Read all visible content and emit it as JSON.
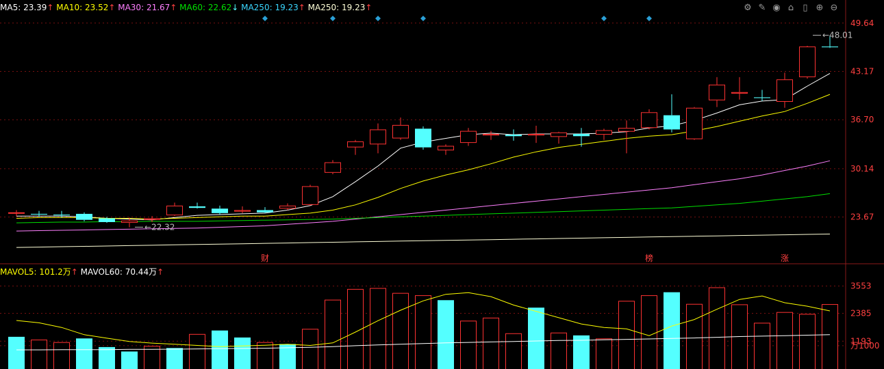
{
  "chart_data": {
    "type": "candlestick",
    "price_panel": {
      "y_ticks": [
        "49.64",
        "43.17",
        "36.70",
        "30.14",
        "23.67"
      ],
      "ylim": [
        17.6,
        50.9
      ],
      "annotations": [
        {
          "text": "48.01",
          "candle_index": 35,
          "price": 48.01,
          "kind": "high"
        },
        {
          "text": "22.32",
          "candle_index": 5,
          "price": 22.32,
          "kind": "low"
        }
      ],
      "event_markers": [
        {
          "text": "财",
          "candle_index": 11
        },
        {
          "text": "榜",
          "candle_index": 28
        },
        {
          "text": "涨",
          "candle_index": 34
        }
      ],
      "top_markers": [
        11,
        14,
        16,
        18,
        26,
        28
      ],
      "candles": [
        {
          "o": 24.2,
          "h": 24.6,
          "l": 23.8,
          "c": 24.3
        },
        {
          "o": 24.1,
          "h": 24.5,
          "l": 23.7,
          "c": 24.0
        },
        {
          "o": 24.0,
          "h": 24.5,
          "l": 23.6,
          "c": 23.9
        },
        {
          "o": 24.1,
          "h": 24.3,
          "l": 23.1,
          "c": 23.3
        },
        {
          "o": 23.5,
          "h": 23.7,
          "l": 22.9,
          "c": 23.0
        },
        {
          "o": 22.9,
          "h": 23.6,
          "l": 22.3,
          "c": 23.2
        },
        {
          "o": 23.3,
          "h": 23.8,
          "l": 23.0,
          "c": 23.5
        },
        {
          "o": 23.9,
          "h": 25.6,
          "l": 23.8,
          "c": 25.2
        },
        {
          "o": 25.1,
          "h": 25.6,
          "l": 24.8,
          "c": 24.9
        },
        {
          "o": 24.8,
          "h": 25.2,
          "l": 24.0,
          "c": 24.2
        },
        {
          "o": 24.4,
          "h": 25.1,
          "l": 24.2,
          "c": 24.6
        },
        {
          "o": 24.6,
          "h": 25.0,
          "l": 24.2,
          "c": 24.3
        },
        {
          "o": 24.8,
          "h": 25.5,
          "l": 24.6,
          "c": 25.2
        },
        {
          "o": 25.3,
          "h": 28.0,
          "l": 25.2,
          "c": 27.8
        },
        {
          "o": 29.6,
          "h": 31.3,
          "l": 29.4,
          "c": 31.0
        },
        {
          "o": 33.0,
          "h": 34.0,
          "l": 32.0,
          "c": 33.8
        },
        {
          "o": 33.4,
          "h": 36.2,
          "l": 32.2,
          "c": 35.4
        },
        {
          "o": 34.2,
          "h": 37.0,
          "l": 34.0,
          "c": 36.0
        },
        {
          "o": 35.5,
          "h": 35.8,
          "l": 32.7,
          "c": 33.0
        },
        {
          "o": 32.6,
          "h": 33.4,
          "l": 32.0,
          "c": 33.2
        },
        {
          "o": 33.6,
          "h": 35.6,
          "l": 33.2,
          "c": 35.2
        },
        {
          "o": 34.6,
          "h": 35.2,
          "l": 34.0,
          "c": 34.8
        },
        {
          "o": 34.7,
          "h": 35.4,
          "l": 33.9,
          "c": 34.5
        },
        {
          "o": 34.6,
          "h": 35.9,
          "l": 33.6,
          "c": 34.8
        },
        {
          "o": 34.4,
          "h": 35.1,
          "l": 33.5,
          "c": 35.0
        },
        {
          "o": 34.8,
          "h": 35.6,
          "l": 33.1,
          "c": 34.5
        },
        {
          "o": 34.7,
          "h": 35.5,
          "l": 34.0,
          "c": 35.3
        },
        {
          "o": 35.1,
          "h": 36.6,
          "l": 32.2,
          "c": 35.6
        },
        {
          "o": 35.6,
          "h": 38.1,
          "l": 35.4,
          "c": 37.7
        },
        {
          "o": 37.3,
          "h": 40.1,
          "l": 35.0,
          "c": 35.4
        },
        {
          "o": 34.1,
          "h": 38.4,
          "l": 34.0,
          "c": 38.3
        },
        {
          "o": 39.3,
          "h": 42.4,
          "l": 38.4,
          "c": 41.4
        },
        {
          "o": 40.2,
          "h": 42.4,
          "l": 39.4,
          "c": 40.4
        },
        {
          "o": 39.7,
          "h": 40.7,
          "l": 39.2,
          "c": 39.6
        },
        {
          "o": 39.1,
          "h": 43.0,
          "l": 38.3,
          "c": 42.1
        },
        {
          "o": 42.4,
          "h": 46.6,
          "l": 42.2,
          "c": 46.5
        },
        {
          "o": 46.5,
          "h": 48.0,
          "l": 46.3,
          "c": 46.4
        }
      ],
      "ma_lines": [
        {
          "name": "MA5",
          "color": "#ffffff",
          "values": [
            23.8,
            23.8,
            23.8,
            23.7,
            23.5,
            23.4,
            23.3,
            23.6,
            23.9,
            24.0,
            24.1,
            24.2,
            24.6,
            25.2,
            26.4,
            28.4,
            30.5,
            32.9,
            33.7,
            34.2,
            34.7,
            34.9,
            34.7,
            34.8,
            34.8,
            34.8,
            34.9,
            35.1,
            35.6,
            35.9,
            36.6,
            37.6,
            38.7,
            39.2,
            39.4,
            41.2,
            42.9
          ]
        },
        {
          "name": "MA10",
          "color": "#ffff00",
          "values": [
            23.5,
            23.6,
            23.6,
            23.6,
            23.5,
            23.5,
            23.4,
            23.5,
            23.6,
            23.7,
            23.8,
            23.8,
            24.0,
            24.2,
            24.6,
            25.3,
            26.3,
            27.5,
            28.5,
            29.3,
            30.0,
            30.8,
            31.7,
            32.4,
            33.0,
            33.4,
            33.8,
            34.2,
            34.5,
            34.7,
            35.2,
            35.8,
            36.5,
            37.2,
            37.8,
            38.9,
            40.1
          ]
        },
        {
          "name": "MA30",
          "color": "#ff80ff",
          "values": [
            21.8,
            21.85,
            21.9,
            21.95,
            22.0,
            22.05,
            22.1,
            22.15,
            22.2,
            22.3,
            22.4,
            22.5,
            22.7,
            22.9,
            23.1,
            23.4,
            23.7,
            24.0,
            24.3,
            24.6,
            24.9,
            25.2,
            25.5,
            25.8,
            26.1,
            26.4,
            26.7,
            27.0,
            27.3,
            27.6,
            28.0,
            28.4,
            28.8,
            29.3,
            29.9,
            30.5,
            31.2
          ]
        },
        {
          "name": "MA60",
          "color": "#00e000",
          "values": [
            22.9,
            22.95,
            23.0,
            23.0,
            23.05,
            23.05,
            23.1,
            23.1,
            23.1,
            23.15,
            23.2,
            23.25,
            23.3,
            23.35,
            23.4,
            23.5,
            23.6,
            23.7,
            23.8,
            23.9,
            24.0,
            24.1,
            24.2,
            24.3,
            24.4,
            24.5,
            24.6,
            24.7,
            24.8,
            24.9,
            25.1,
            25.3,
            25.5,
            25.8,
            26.1,
            26.4,
            26.8
          ]
        },
        {
          "name": "MA250",
          "color": "#ffffd8",
          "values": [
            19.6,
            19.65,
            19.7,
            19.75,
            19.8,
            19.85,
            19.9,
            19.95,
            20.0,
            20.05,
            20.1,
            20.15,
            20.2,
            20.25,
            20.3,
            20.35,
            20.4,
            20.45,
            20.5,
            20.55,
            20.6,
            20.65,
            20.7,
            20.75,
            20.8,
            20.85,
            20.9,
            20.95,
            21.0,
            21.05,
            21.1,
            21.15,
            21.2,
            21.25,
            21.3,
            21.35,
            21.4
          ]
        }
      ]
    },
    "volume_panel": {
      "y_ticks": [
        "3553",
        "2385",
        "1193",
        "万1000"
      ],
      "ylim": [
        0,
        4100
      ],
      "bars": [
        {
          "v": 1380,
          "down": true
        },
        {
          "v": 1260,
          "down": false
        },
        {
          "v": 1150,
          "down": false
        },
        {
          "v": 1310,
          "down": true
        },
        {
          "v": 940,
          "down": true
        },
        {
          "v": 750,
          "down": true
        },
        {
          "v": 990,
          "down": false
        },
        {
          "v": 900,
          "down": true
        },
        {
          "v": 1500,
          "down": false
        },
        {
          "v": 1650,
          "down": true
        },
        {
          "v": 1350,
          "down": true
        },
        {
          "v": 1150,
          "down": false
        },
        {
          "v": 1070,
          "down": true
        },
        {
          "v": 1720,
          "down": false
        },
        {
          "v": 2970,
          "down": false
        },
        {
          "v": 3430,
          "down": false
        },
        {
          "v": 3470,
          "down": false
        },
        {
          "v": 3260,
          "down": false
        },
        {
          "v": 3160,
          "down": false
        },
        {
          "v": 2950,
          "down": true
        },
        {
          "v": 2070,
          "down": false
        },
        {
          "v": 2200,
          "down": false
        },
        {
          "v": 1530,
          "down": false
        },
        {
          "v": 2630,
          "down": true
        },
        {
          "v": 1560,
          "down": false
        },
        {
          "v": 1440,
          "down": true
        },
        {
          "v": 1310,
          "down": false
        },
        {
          "v": 2920,
          "down": false
        },
        {
          "v": 3160,
          "down": false
        },
        {
          "v": 3290,
          "down": true
        },
        {
          "v": 2790,
          "down": false
        },
        {
          "v": 3500,
          "down": false
        },
        {
          "v": 2770,
          "down": false
        },
        {
          "v": 1980,
          "down": false
        },
        {
          "v": 2440,
          "down": false
        },
        {
          "v": 2360,
          "down": false
        },
        {
          "v": 2780,
          "down": false
        }
      ],
      "mavol_lines": [
        {
          "name": "MAVOL5",
          "color": "#ffff00",
          "values": [
            2080,
            1980,
            1780,
            1470,
            1320,
            1180,
            1110,
            1060,
            1010,
            960,
            990,
            1020,
            1060,
            1010,
            1120,
            1580,
            2070,
            2520,
            2920,
            3200,
            3270,
            3100,
            2740,
            2470,
            2200,
            1930,
            1780,
            1720,
            1430,
            1840,
            2120,
            2560,
            2980,
            3130,
            2840,
            2690,
            2490
          ]
        },
        {
          "name": "MAVOL60",
          "color": "#ffffff",
          "values": [
            820,
            820,
            830,
            830,
            830,
            840,
            840,
            850,
            860,
            870,
            880,
            890,
            910,
            930,
            960,
            1000,
            1030,
            1060,
            1090,
            1120,
            1140,
            1160,
            1180,
            1200,
            1220,
            1230,
            1250,
            1270,
            1290,
            1310,
            1330,
            1360,
            1390,
            1410,
            1430,
            1450,
            1470
          ]
        }
      ]
    }
  },
  "legend_top": [
    {
      "label": "MA5: ",
      "value": "23.39",
      "arrow": "↑",
      "color": "#ffffff"
    },
    {
      "label": "MA10: ",
      "value": "23.52",
      "arrow": "↑",
      "color": "#ffff00"
    },
    {
      "label": "MA30: ",
      "value": "21.67",
      "arrow": "↑",
      "color": "#ff80ff"
    },
    {
      "label": "MA60: ",
      "value": "22.62",
      "arrow": "↓",
      "color": "#00e000"
    },
    {
      "label": "MA250: ",
      "value": "19.23",
      "arrow": "↑",
      "color": "#3ad7ff"
    },
    {
      "label": "MA250: ",
      "value": "19.23",
      "arrow": "↑",
      "color": "#ffffd8"
    }
  ],
  "legend_vol": [
    {
      "label": "MAVOL5: ",
      "value": "101.2万",
      "arrow": "↑",
      "color": "#ffff00"
    },
    {
      "label": "MAVOL60: ",
      "value": "70.44万",
      "arrow": "↑",
      "color": "#ffffff"
    }
  ],
  "toolbar": [
    {
      "name": "settings-icon",
      "glyph": "⚙"
    },
    {
      "name": "draw-pen-icon",
      "glyph": "✎"
    },
    {
      "name": "eye-icon",
      "glyph": "◉"
    },
    {
      "name": "store-icon",
      "glyph": "⌂"
    },
    {
      "name": "bookmark-icon",
      "glyph": "▯"
    },
    {
      "name": "zoom-in-icon",
      "glyph": "⊕"
    },
    {
      "name": "zoom-out-icon",
      "glyph": "⊖"
    }
  ],
  "colors": {
    "up": "#ff3232",
    "down": "#54ffff",
    "axis_text": "#ff4040",
    "grid": "#7a1010",
    "marker": "#2a9fd6",
    "event_text": "#ff4040"
  }
}
